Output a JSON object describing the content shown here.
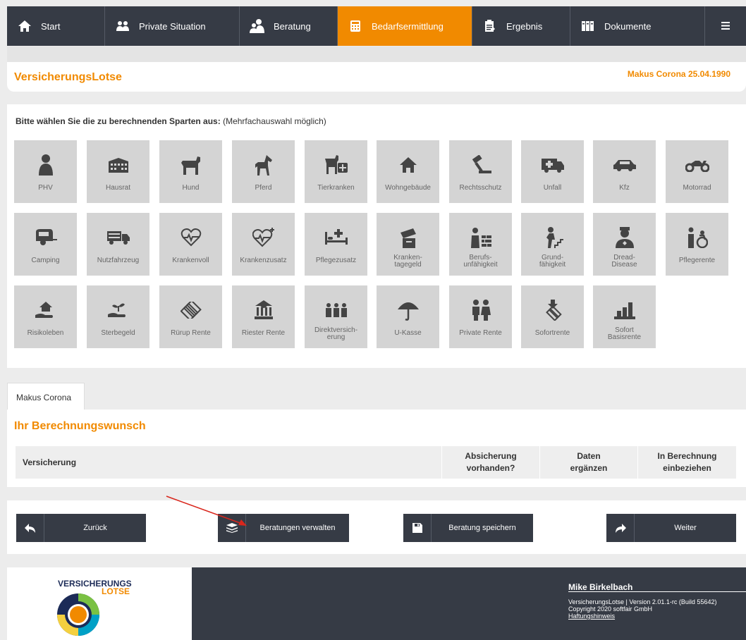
{
  "nav": {
    "items": [
      {
        "label": "Start",
        "icon": "home-icon"
      },
      {
        "label": "Private Situation",
        "icon": "users-icon"
      },
      {
        "label": "Beratung",
        "icon": "consulting-icon"
      },
      {
        "label": "Bedarfsermittlung",
        "icon": "calculator-icon",
        "active": true
      },
      {
        "label": "Ergebnis",
        "icon": "clipboard-icon"
      },
      {
        "label": "Dokumente",
        "icon": "document-icon"
      }
    ],
    "menu_icon": "hamburger-icon"
  },
  "header": {
    "brand": "VersicherungsLotse",
    "client": "Makus Corona 25.04.1990"
  },
  "selection": {
    "prompt_bold": "Bitte wählen Sie die zu berechnenden Sparten aus:",
    "prompt_note": "(Mehrfachauswahl möglich)",
    "tiles": [
      {
        "label": "PHV",
        "icon": "person-icon"
      },
      {
        "label": "Hausrat",
        "icon": "building-icon"
      },
      {
        "label": "Hund",
        "icon": "dog-icon"
      },
      {
        "label": "Pferd",
        "icon": "horse-icon"
      },
      {
        "label": "Tierkranken",
        "icon": "pet-medical-icon"
      },
      {
        "label": "Wohngebäude",
        "icon": "house-icon"
      },
      {
        "label": "Rechtsschutz",
        "icon": "gavel-icon"
      },
      {
        "label": "Unfall",
        "icon": "ambulance-icon"
      },
      {
        "label": "Kfz",
        "icon": "car-icon"
      },
      {
        "label": "Motorrad",
        "icon": "motorcycle-icon"
      },
      {
        "label": "Camping",
        "icon": "caravan-icon"
      },
      {
        "label": "Nutzfahrzeug",
        "icon": "truck-icon"
      },
      {
        "label": "Krankenvoll",
        "icon": "heart-hand-icon"
      },
      {
        "label": "Krankenzusatz",
        "icon": "heart-plus-icon"
      },
      {
        "label": "Pflegezusatz",
        "icon": "care-bed-icon"
      },
      {
        "label": "Kranken-\ntagegeld",
        "icon": "money-hand-icon"
      },
      {
        "label": "Berufs-\nunfähigkeit",
        "icon": "worker-icon"
      },
      {
        "label": "Grund-\nfähigkeit",
        "icon": "stairs-person-icon"
      },
      {
        "label": "Dread-\nDisease",
        "icon": "doctor-icon"
      },
      {
        "label": "Pflegerente",
        "icon": "wheelchair-icon"
      },
      {
        "label": "Risikoleben",
        "icon": "house-hand-icon"
      },
      {
        "label": "Sterbegeld",
        "icon": "plant-hand-icon"
      },
      {
        "label": "Rürup Rente",
        "icon": "bills-icon"
      },
      {
        "label": "Riester Rente",
        "icon": "government-icon"
      },
      {
        "label": "Direktversich-\nerung",
        "icon": "group-icon"
      },
      {
        "label": "U-Kasse",
        "icon": "umbrella-icon"
      },
      {
        "label": "Private Rente",
        "icon": "couple-icon"
      },
      {
        "label": "Sofortrente",
        "icon": "bills-down-icon"
      },
      {
        "label": "Sofort\nBasisrente",
        "icon": "coins-chart-icon"
      }
    ]
  },
  "calc": {
    "tab": "Makus Corona",
    "title": "Ihr Berechnungswunsch",
    "columns": [
      "Versicherung",
      "Absicherung\nvorhanden?",
      "Daten\nergänzen",
      "In Berechnung\neinbeziehen"
    ]
  },
  "buttons": {
    "back": "Zurück",
    "manage": "Beratungen verwalten",
    "save": "Beratung speichern",
    "next": "Weiter"
  },
  "footer": {
    "logo_line1": "VERSICHERUNGS",
    "logo_line2": "LOTSE",
    "user": "Mike Birkelbach",
    "version": "VersicherungsLotse | Version 2.01.1-rc (Build 55642)",
    "copyright": "Copyright 2020 softfair GmbH",
    "link": "Haftungshinweis"
  },
  "colors": {
    "accent": "#f18a00",
    "dark": "#363b45",
    "tile": "#d4d4d4"
  }
}
